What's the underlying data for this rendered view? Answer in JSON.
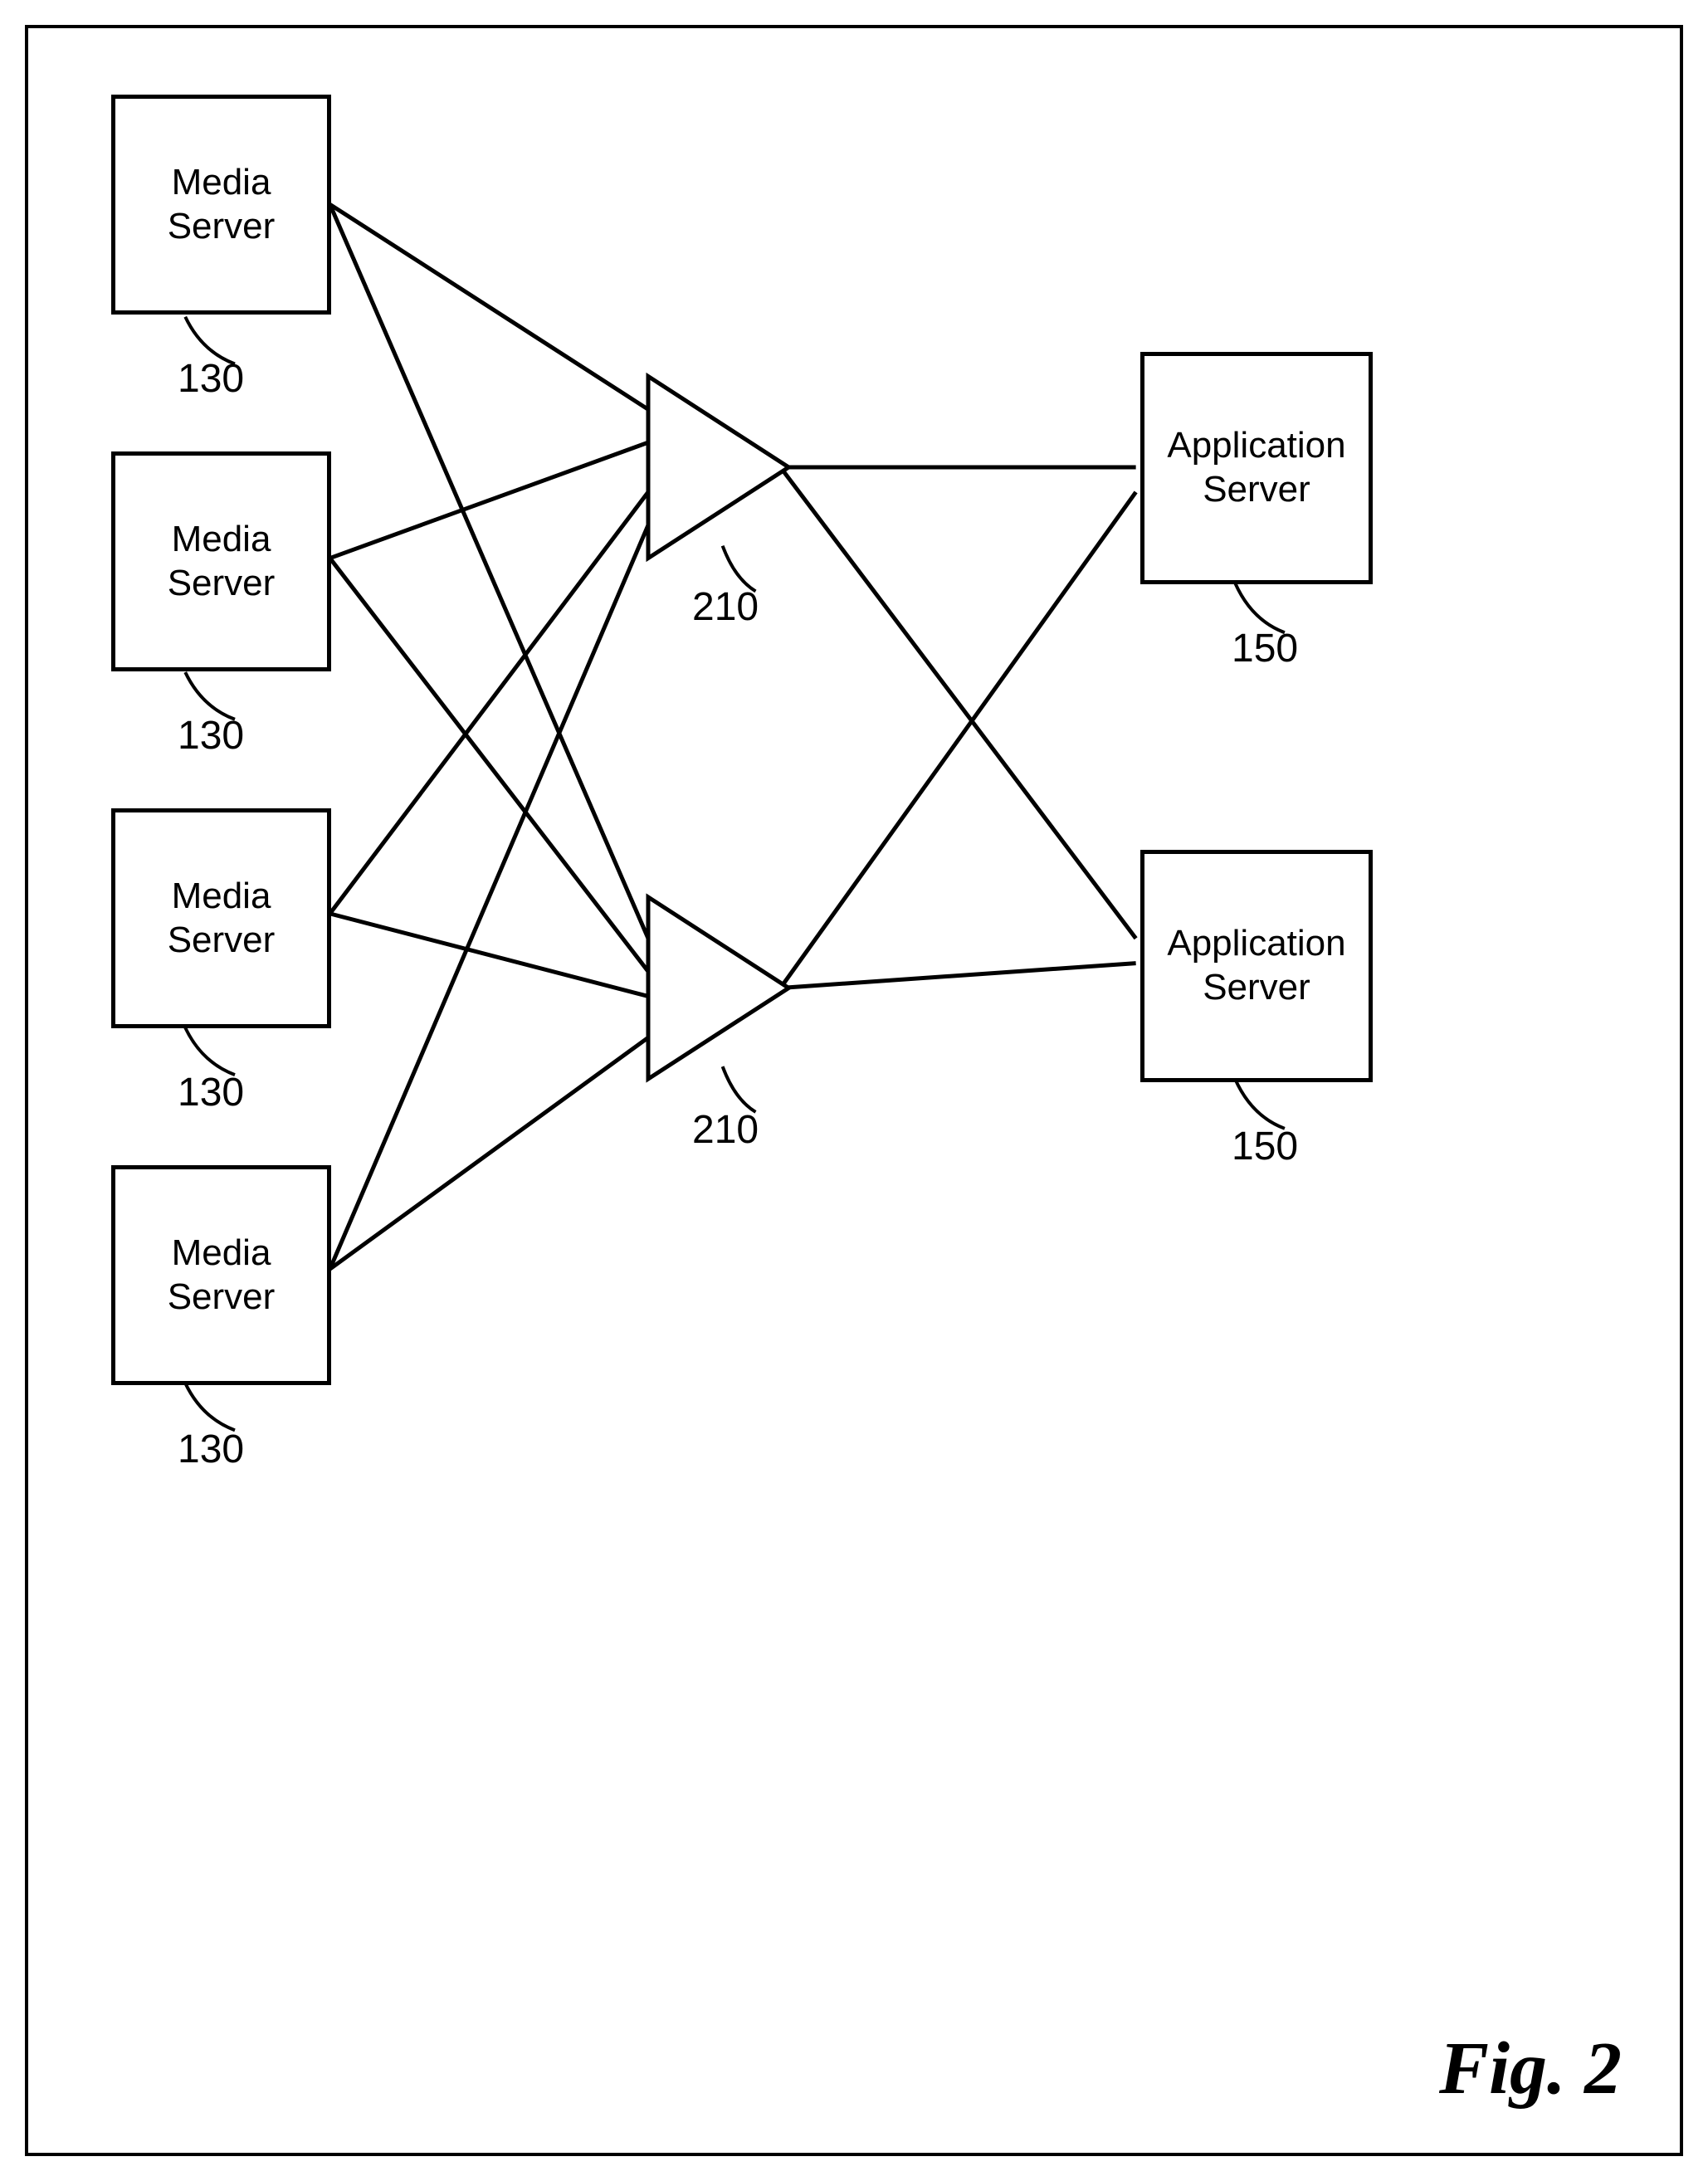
{
  "nodes": {
    "media_server_1": {
      "line1": "Media",
      "line2": "Server",
      "ref": "130"
    },
    "media_server_2": {
      "line1": "Media",
      "line2": "Server",
      "ref": "130"
    },
    "media_server_3": {
      "line1": "Media",
      "line2": "Server",
      "ref": "130"
    },
    "media_server_4": {
      "line1": "Media",
      "line2": "Server",
      "ref": "130"
    },
    "app_server_1": {
      "line1": "Application",
      "line2": "Server",
      "ref": "150"
    },
    "app_server_2": {
      "line1": "Application",
      "line2": "Server",
      "ref": "150"
    },
    "triangle_1": {
      "ref": "210"
    },
    "triangle_2": {
      "ref": "210"
    }
  },
  "figure_label": "Fig. 2"
}
